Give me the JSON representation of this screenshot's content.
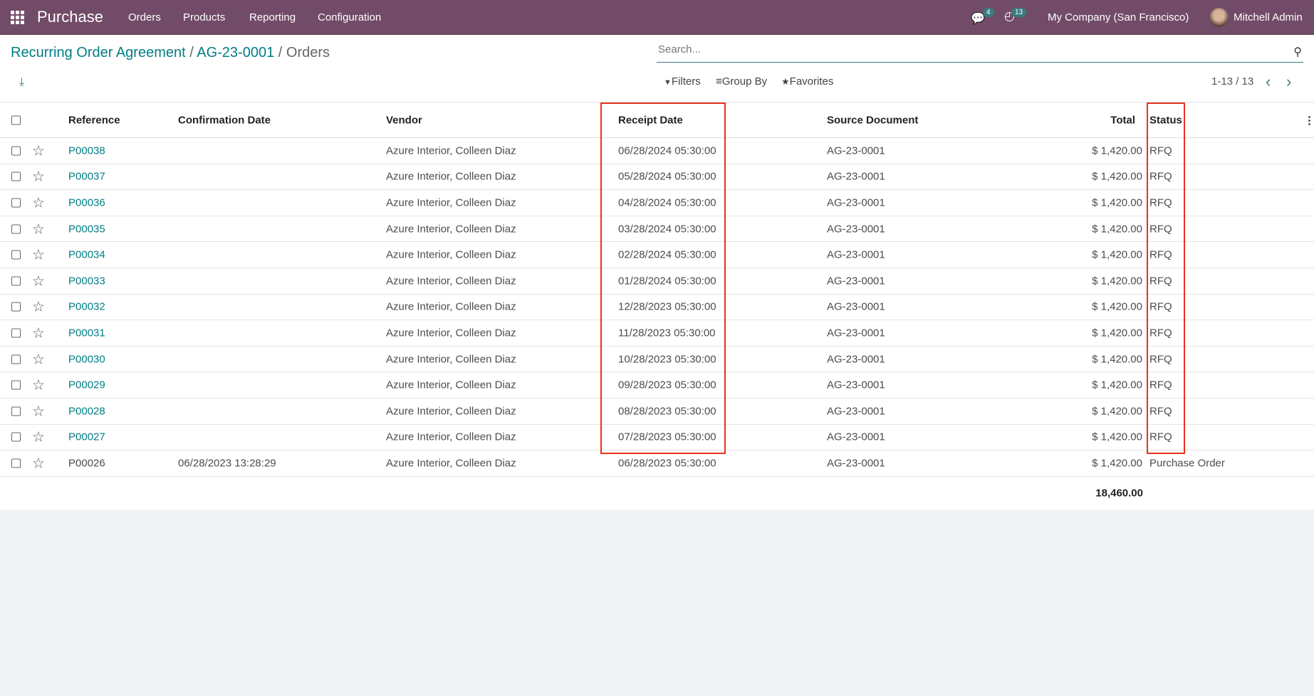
{
  "nav": {
    "app": "Purchase",
    "menu": [
      "Orders",
      "Products",
      "Reporting",
      "Configuration"
    ],
    "messages_count": "4",
    "activities_count": "13",
    "company": "My Company (San Francisco)",
    "user": "Mitchell Admin"
  },
  "breadcrumb": {
    "parts": [
      "Recurring Order Agreement",
      "AG-23-0001"
    ],
    "current": "Orders",
    "sep": " / "
  },
  "search": {
    "placeholder": "Search..."
  },
  "filters": {
    "filters": "Filters",
    "group_by": "Group By",
    "favorites": "Favorites"
  },
  "pager": "1-13 / 13",
  "columns": [
    "Reference",
    "Confirmation Date",
    "Vendor",
    "Receipt Date",
    "Source Document",
    "Total",
    "Status"
  ],
  "rows": [
    {
      "ref": "P00038",
      "conf": "",
      "vendor": "Azure Interior, Colleen Diaz",
      "receipt": "06/28/2024 05:30:00",
      "source": "AG-23-0001",
      "total": "$ 1,420.00",
      "status": "RFQ"
    },
    {
      "ref": "P00037",
      "conf": "",
      "vendor": "Azure Interior, Colleen Diaz",
      "receipt": "05/28/2024 05:30:00",
      "source": "AG-23-0001",
      "total": "$ 1,420.00",
      "status": "RFQ"
    },
    {
      "ref": "P00036",
      "conf": "",
      "vendor": "Azure Interior, Colleen Diaz",
      "receipt": "04/28/2024 05:30:00",
      "source": "AG-23-0001",
      "total": "$ 1,420.00",
      "status": "RFQ"
    },
    {
      "ref": "P00035",
      "conf": "",
      "vendor": "Azure Interior, Colleen Diaz",
      "receipt": "03/28/2024 05:30:00",
      "source": "AG-23-0001",
      "total": "$ 1,420.00",
      "status": "RFQ"
    },
    {
      "ref": "P00034",
      "conf": "",
      "vendor": "Azure Interior, Colleen Diaz",
      "receipt": "02/28/2024 05:30:00",
      "source": "AG-23-0001",
      "total": "$ 1,420.00",
      "status": "RFQ"
    },
    {
      "ref": "P00033",
      "conf": "",
      "vendor": "Azure Interior, Colleen Diaz",
      "receipt": "01/28/2024 05:30:00",
      "source": "AG-23-0001",
      "total": "$ 1,420.00",
      "status": "RFQ"
    },
    {
      "ref": "P00032",
      "conf": "",
      "vendor": "Azure Interior, Colleen Diaz",
      "receipt": "12/28/2023 05:30:00",
      "source": "AG-23-0001",
      "total": "$ 1,420.00",
      "status": "RFQ"
    },
    {
      "ref": "P00031",
      "conf": "",
      "vendor": "Azure Interior, Colleen Diaz",
      "receipt": "11/28/2023 05:30:00",
      "source": "AG-23-0001",
      "total": "$ 1,420.00",
      "status": "RFQ"
    },
    {
      "ref": "P00030",
      "conf": "",
      "vendor": "Azure Interior, Colleen Diaz",
      "receipt": "10/28/2023 05:30:00",
      "source": "AG-23-0001",
      "total": "$ 1,420.00",
      "status": "RFQ"
    },
    {
      "ref": "P00029",
      "conf": "",
      "vendor": "Azure Interior, Colleen Diaz",
      "receipt": "09/28/2023 05:30:00",
      "source": "AG-23-0001",
      "total": "$ 1,420.00",
      "status": "RFQ"
    },
    {
      "ref": "P00028",
      "conf": "",
      "vendor": "Azure Interior, Colleen Diaz",
      "receipt": "08/28/2023 05:30:00",
      "source": "AG-23-0001",
      "total": "$ 1,420.00",
      "status": "RFQ"
    },
    {
      "ref": "P00027",
      "conf": "",
      "vendor": "Azure Interior, Colleen Diaz",
      "receipt": "07/28/2023 05:30:00",
      "source": "AG-23-0001",
      "total": "$ 1,420.00",
      "status": "RFQ"
    },
    {
      "ref": "P00026",
      "conf": "06/28/2023 13:28:29",
      "vendor": "Azure Interior, Colleen Diaz",
      "receipt": "06/28/2023 05:30:00",
      "source": "AG-23-0001",
      "total": "$ 1,420.00",
      "status": "Purchase Order"
    }
  ],
  "grand_total": "18,460.00",
  "colors": {
    "nav": "#714b67",
    "link": "#017e84",
    "highlight": "#e8321f"
  }
}
